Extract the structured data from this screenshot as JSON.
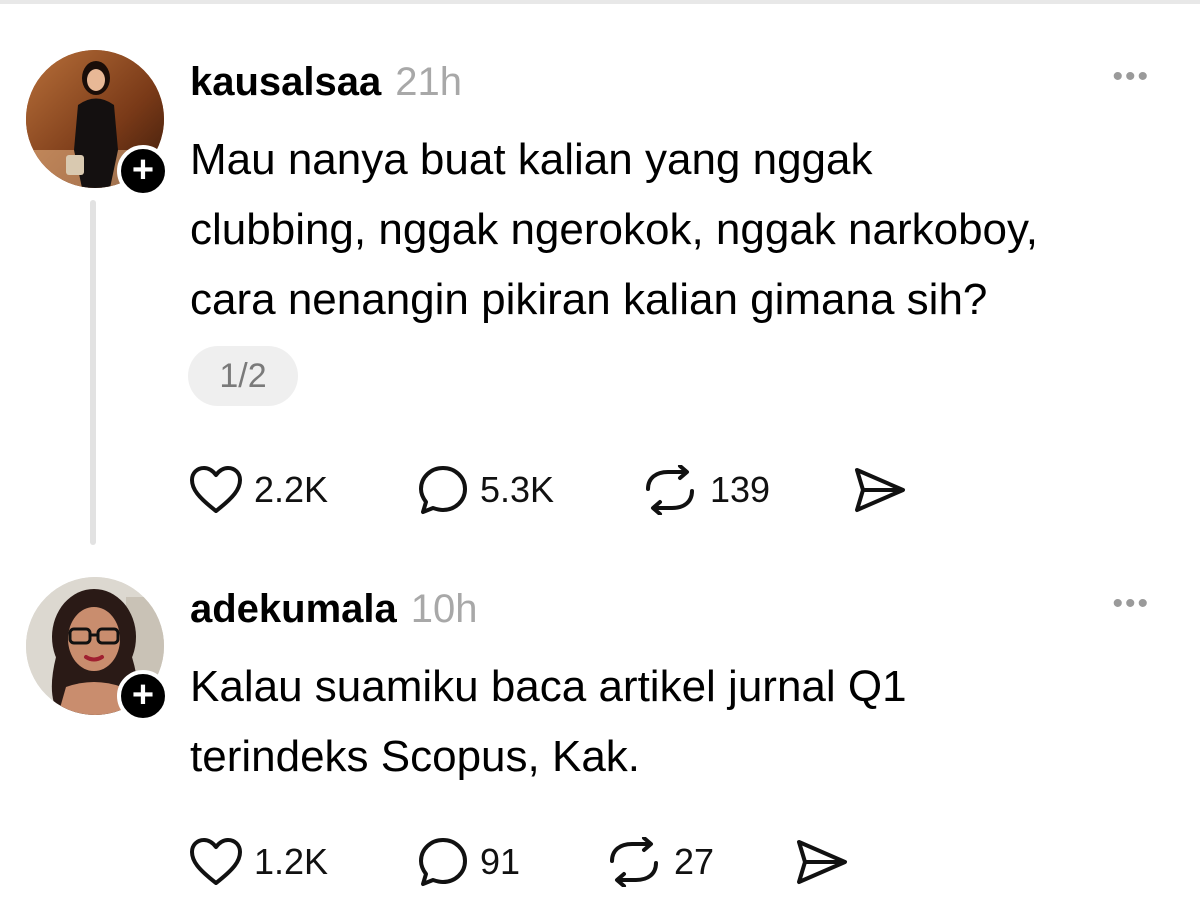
{
  "posts": [
    {
      "username": "kausalsaa",
      "time": "21h",
      "more": "•••",
      "text": "Mau nanya buat kalian yang nggak\nclubbing, nggak ngerokok, nggak narkoboy,\ncara nenangin pikiran kalian gimana sih?",
      "pager": "1/2",
      "likes": "2.2K",
      "replies": "5.3K",
      "reposts": "139"
    },
    {
      "username": "adekumala",
      "time": "10h",
      "more": "•••",
      "text": "Kalau suamiku baca artikel jurnal Q1\nterindeks Scopus, Kak.",
      "likes": "1.2K",
      "replies": "91",
      "reposts": "27"
    }
  ],
  "icons": {
    "follow": "plus-icon",
    "like": "heart-icon",
    "reply": "comment-icon",
    "repost": "repost-icon",
    "share": "send-icon"
  },
  "colors": {
    "muted": "#a8a8a8",
    "pill_bg": "#efefef",
    "thread_line": "#e2e2e2"
  }
}
